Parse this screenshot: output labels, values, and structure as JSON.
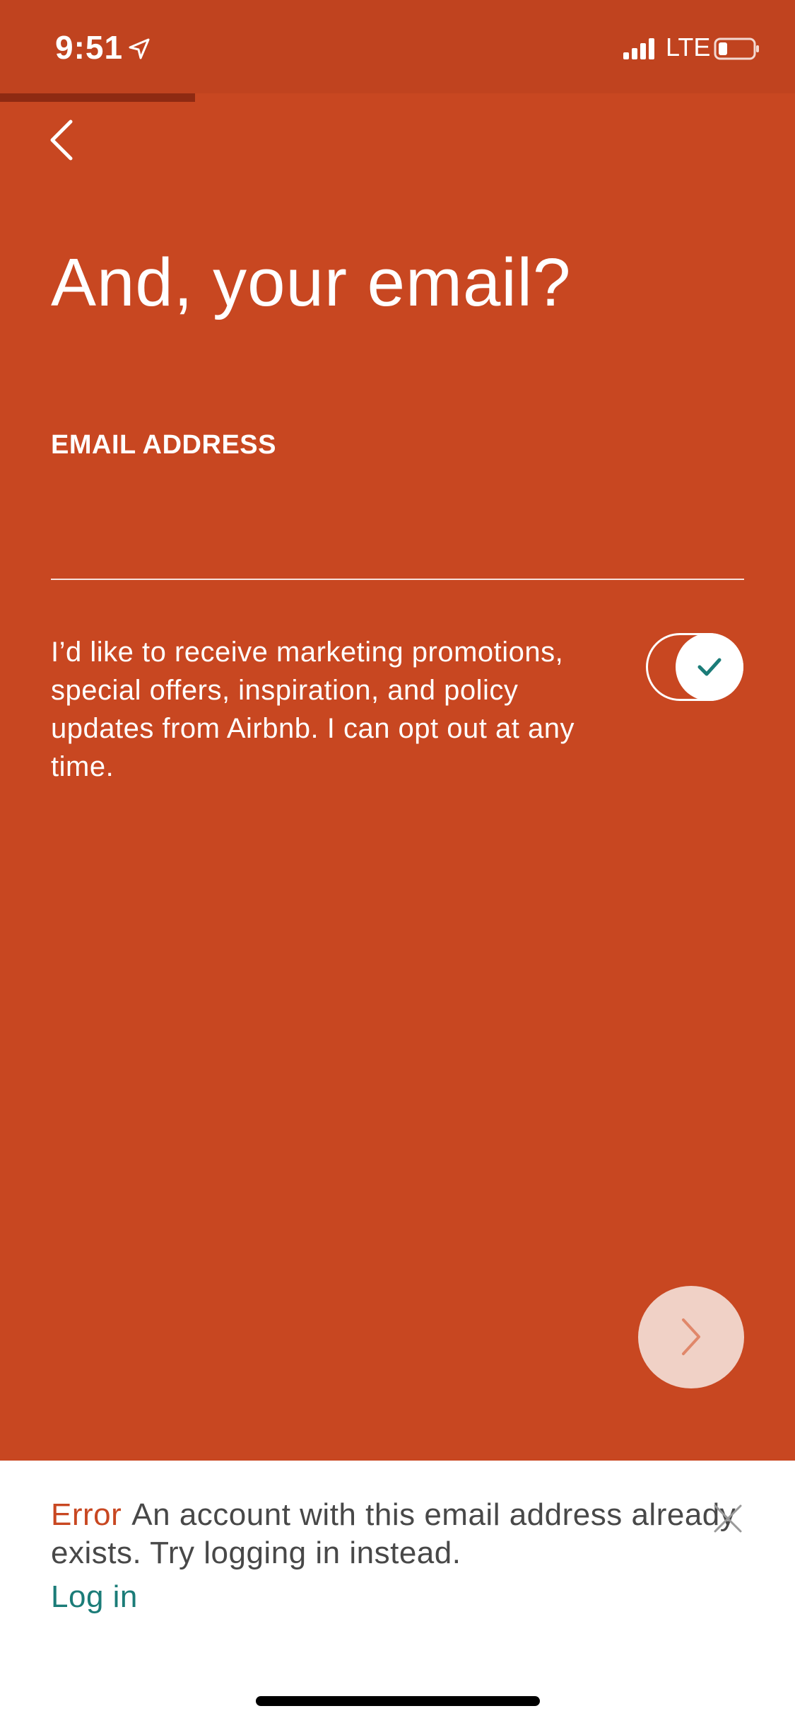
{
  "status_bar": {
    "time": "9:51",
    "network": "LTE"
  },
  "signup": {
    "progress": 0.245,
    "title": "And, your email?",
    "email_label": "EMAIL ADDRESS",
    "email_value": "",
    "marketing_consent": "I’d like to receive marketing promotions, special offers, inspiration, and policy updates from Airbnb. I can opt out at any time.",
    "marketing_opt_in": true
  },
  "error": {
    "label": "Error",
    "message": "An account with this email address already exists. Try logging in instead.",
    "action_label": "Log in"
  },
  "colors": {
    "background": "#c84721",
    "status_bar": "#c0431f",
    "progress_fill": "#8e2a12",
    "accent_teal": "#1b7c78",
    "next_button": "#f0d1c6",
    "error_red": "#c84721"
  },
  "icons": {
    "location": "location-arrow-icon",
    "signal": "cellular-signal-icon",
    "battery": "battery-low-icon",
    "back": "chevron-left-icon",
    "toggle_check": "checkmark-icon",
    "next": "chevron-right-icon",
    "dismiss": "close-icon"
  }
}
